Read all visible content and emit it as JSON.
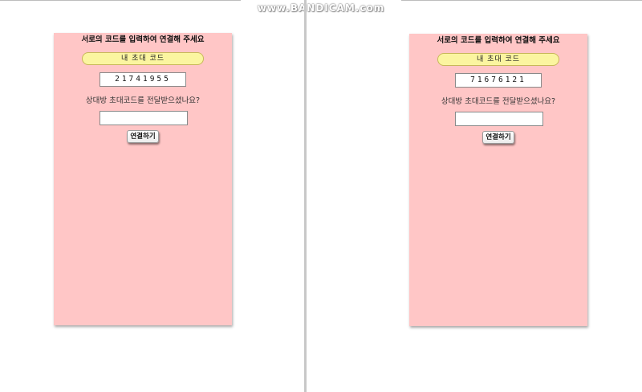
{
  "watermark": "www.BANDICAM.com",
  "panes": [
    {
      "title": "서로의 코드를 입력하여 연결해 주세요",
      "my_code_label": "내 초대 코드",
      "my_code": "21741955",
      "prompt": "상대방 초대코드를 전달받으셨나요?",
      "partner_code_value": "",
      "connect_label": "연결하기"
    },
    {
      "title": "서로의 코드를 입력하여 연결해 주세요",
      "my_code_label": "내 초대 코드",
      "my_code": "71676121",
      "prompt": "상대방 초대코드를 전달받으셨나요?",
      "partner_code_value": "",
      "connect_label": "연결하기"
    }
  ],
  "colors": {
    "card_background": "#ffc6c6",
    "code_label_background": "#fbf5a0",
    "page_background": "#ffffff"
  }
}
